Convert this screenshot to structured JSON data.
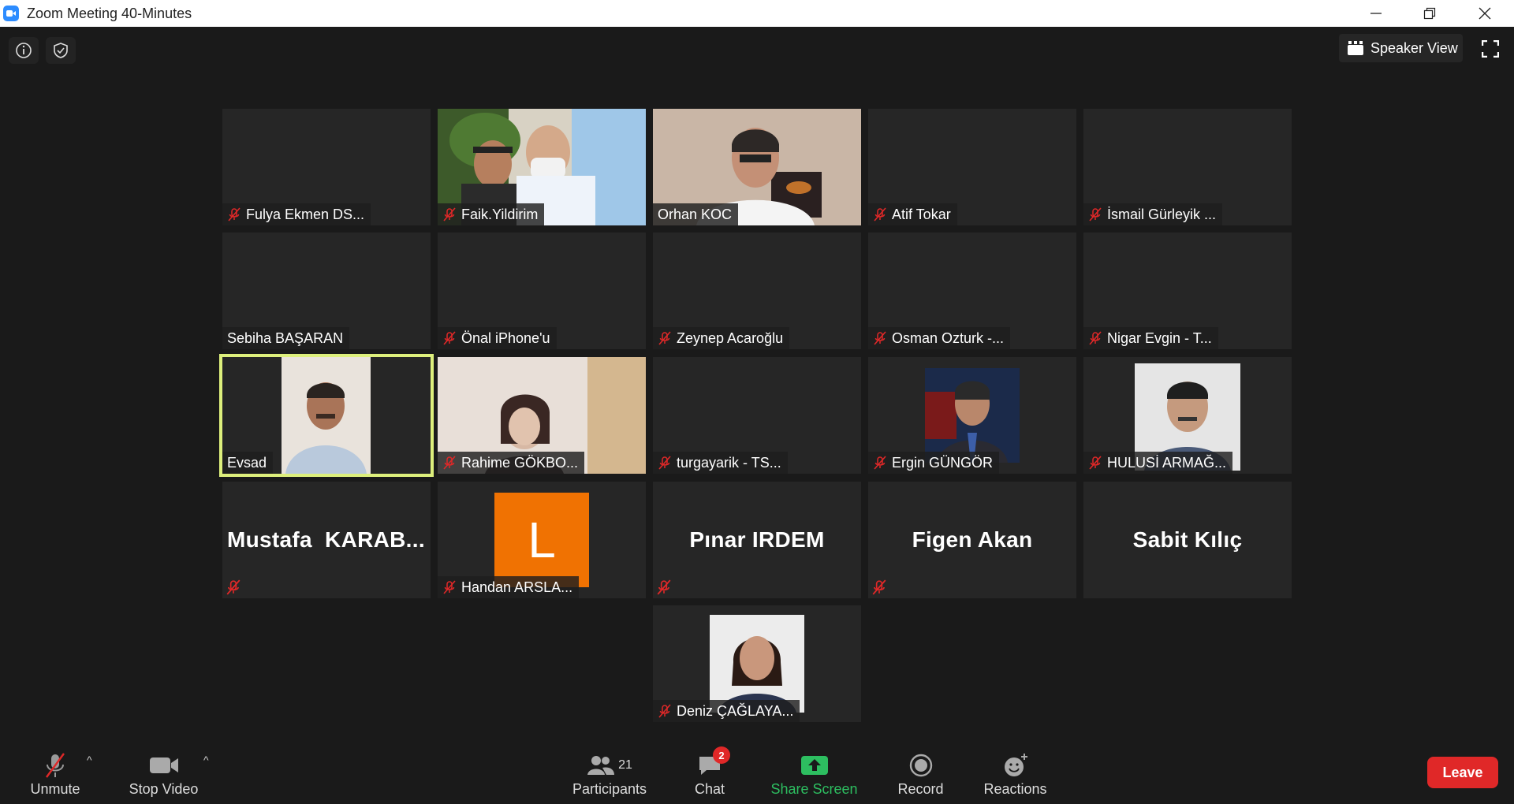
{
  "window": {
    "title": "Zoom Meeting 40-Minutes"
  },
  "top": {
    "speaker_view_label": "Speaker View"
  },
  "tiles": [
    {
      "name": "Fulya Ekmen DS...",
      "muted": true
    },
    {
      "name": "Faik.Yildirim",
      "muted": true
    },
    {
      "name": "Orhan KOC",
      "muted": false
    },
    {
      "name": "Atif Tokar",
      "muted": true
    },
    {
      "name": "İsmail Gürleyik ...",
      "muted": true
    },
    {
      "name": "Sebiha BAŞARAN",
      "muted": false
    },
    {
      "name": "Önal iPhone'u",
      "muted": true
    },
    {
      "name": "Zeynep Acaroğlu",
      "muted": true
    },
    {
      "name": "Osman Ozturk -...",
      "muted": true
    },
    {
      "name": "Nigar Evgin - T...",
      "muted": true
    },
    {
      "name": "Evsad",
      "muted": false
    },
    {
      "name": "Rahime GÖKBO...",
      "muted": true
    },
    {
      "name": "turgayarik - TS...",
      "muted": true
    },
    {
      "name": "Ergin GÜNGÖR",
      "muted": true
    },
    {
      "name": "HULUSİ ARMAĞ...",
      "muted": true
    },
    {
      "name": "Mustafa  KARAB...",
      "muted": true
    },
    {
      "name": "Handan ARSLA...",
      "muted": true,
      "avatar_letter": "L"
    },
    {
      "name": "Pınar IRDEM",
      "muted": true
    },
    {
      "name": "Figen Akan",
      "muted": true
    },
    {
      "name": "Sabit Kılıç",
      "muted": false
    },
    {
      "name": "Deniz ÇAĞLAYA...",
      "muted": true
    }
  ],
  "toolbar": {
    "unmute_label": "Unmute",
    "stop_video_label": "Stop Video",
    "participants_label": "Participants",
    "participants_count": "21",
    "chat_label": "Chat",
    "chat_badge": "2",
    "share_screen_label": "Share Screen",
    "record_label": "Record",
    "reactions_label": "Reactions",
    "leave_label": "Leave"
  },
  "colors": {
    "accent_green": "#2dbe60",
    "leave_red": "#e02828",
    "active_speaker": "#ddef7c",
    "avatar_orange": "#f07202"
  }
}
